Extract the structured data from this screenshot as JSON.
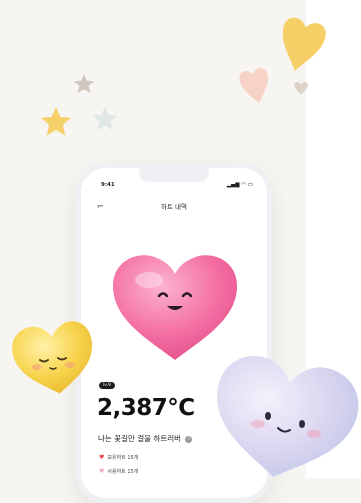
{
  "status": {
    "time": "9:41",
    "icons": "▂▄▆ ◠ ▭"
  },
  "header": {
    "title": "하트 내역"
  },
  "summary": {
    "badge": "lv.9",
    "temperature": "2,387℃",
    "slogan": "나는 꽃길만 걸을 하트러버",
    "info_label": "i"
  },
  "legend": [
    {
      "label": "보유하트 15개",
      "color": "#e8454f"
    },
    {
      "label": "사용하트 15개",
      "color": "#f3a6c0"
    }
  ],
  "colors": {
    "accent_pink": "#f36e9f",
    "heart_yellow": "#f7d24a",
    "heart_lavender": "#d9d3f0"
  }
}
